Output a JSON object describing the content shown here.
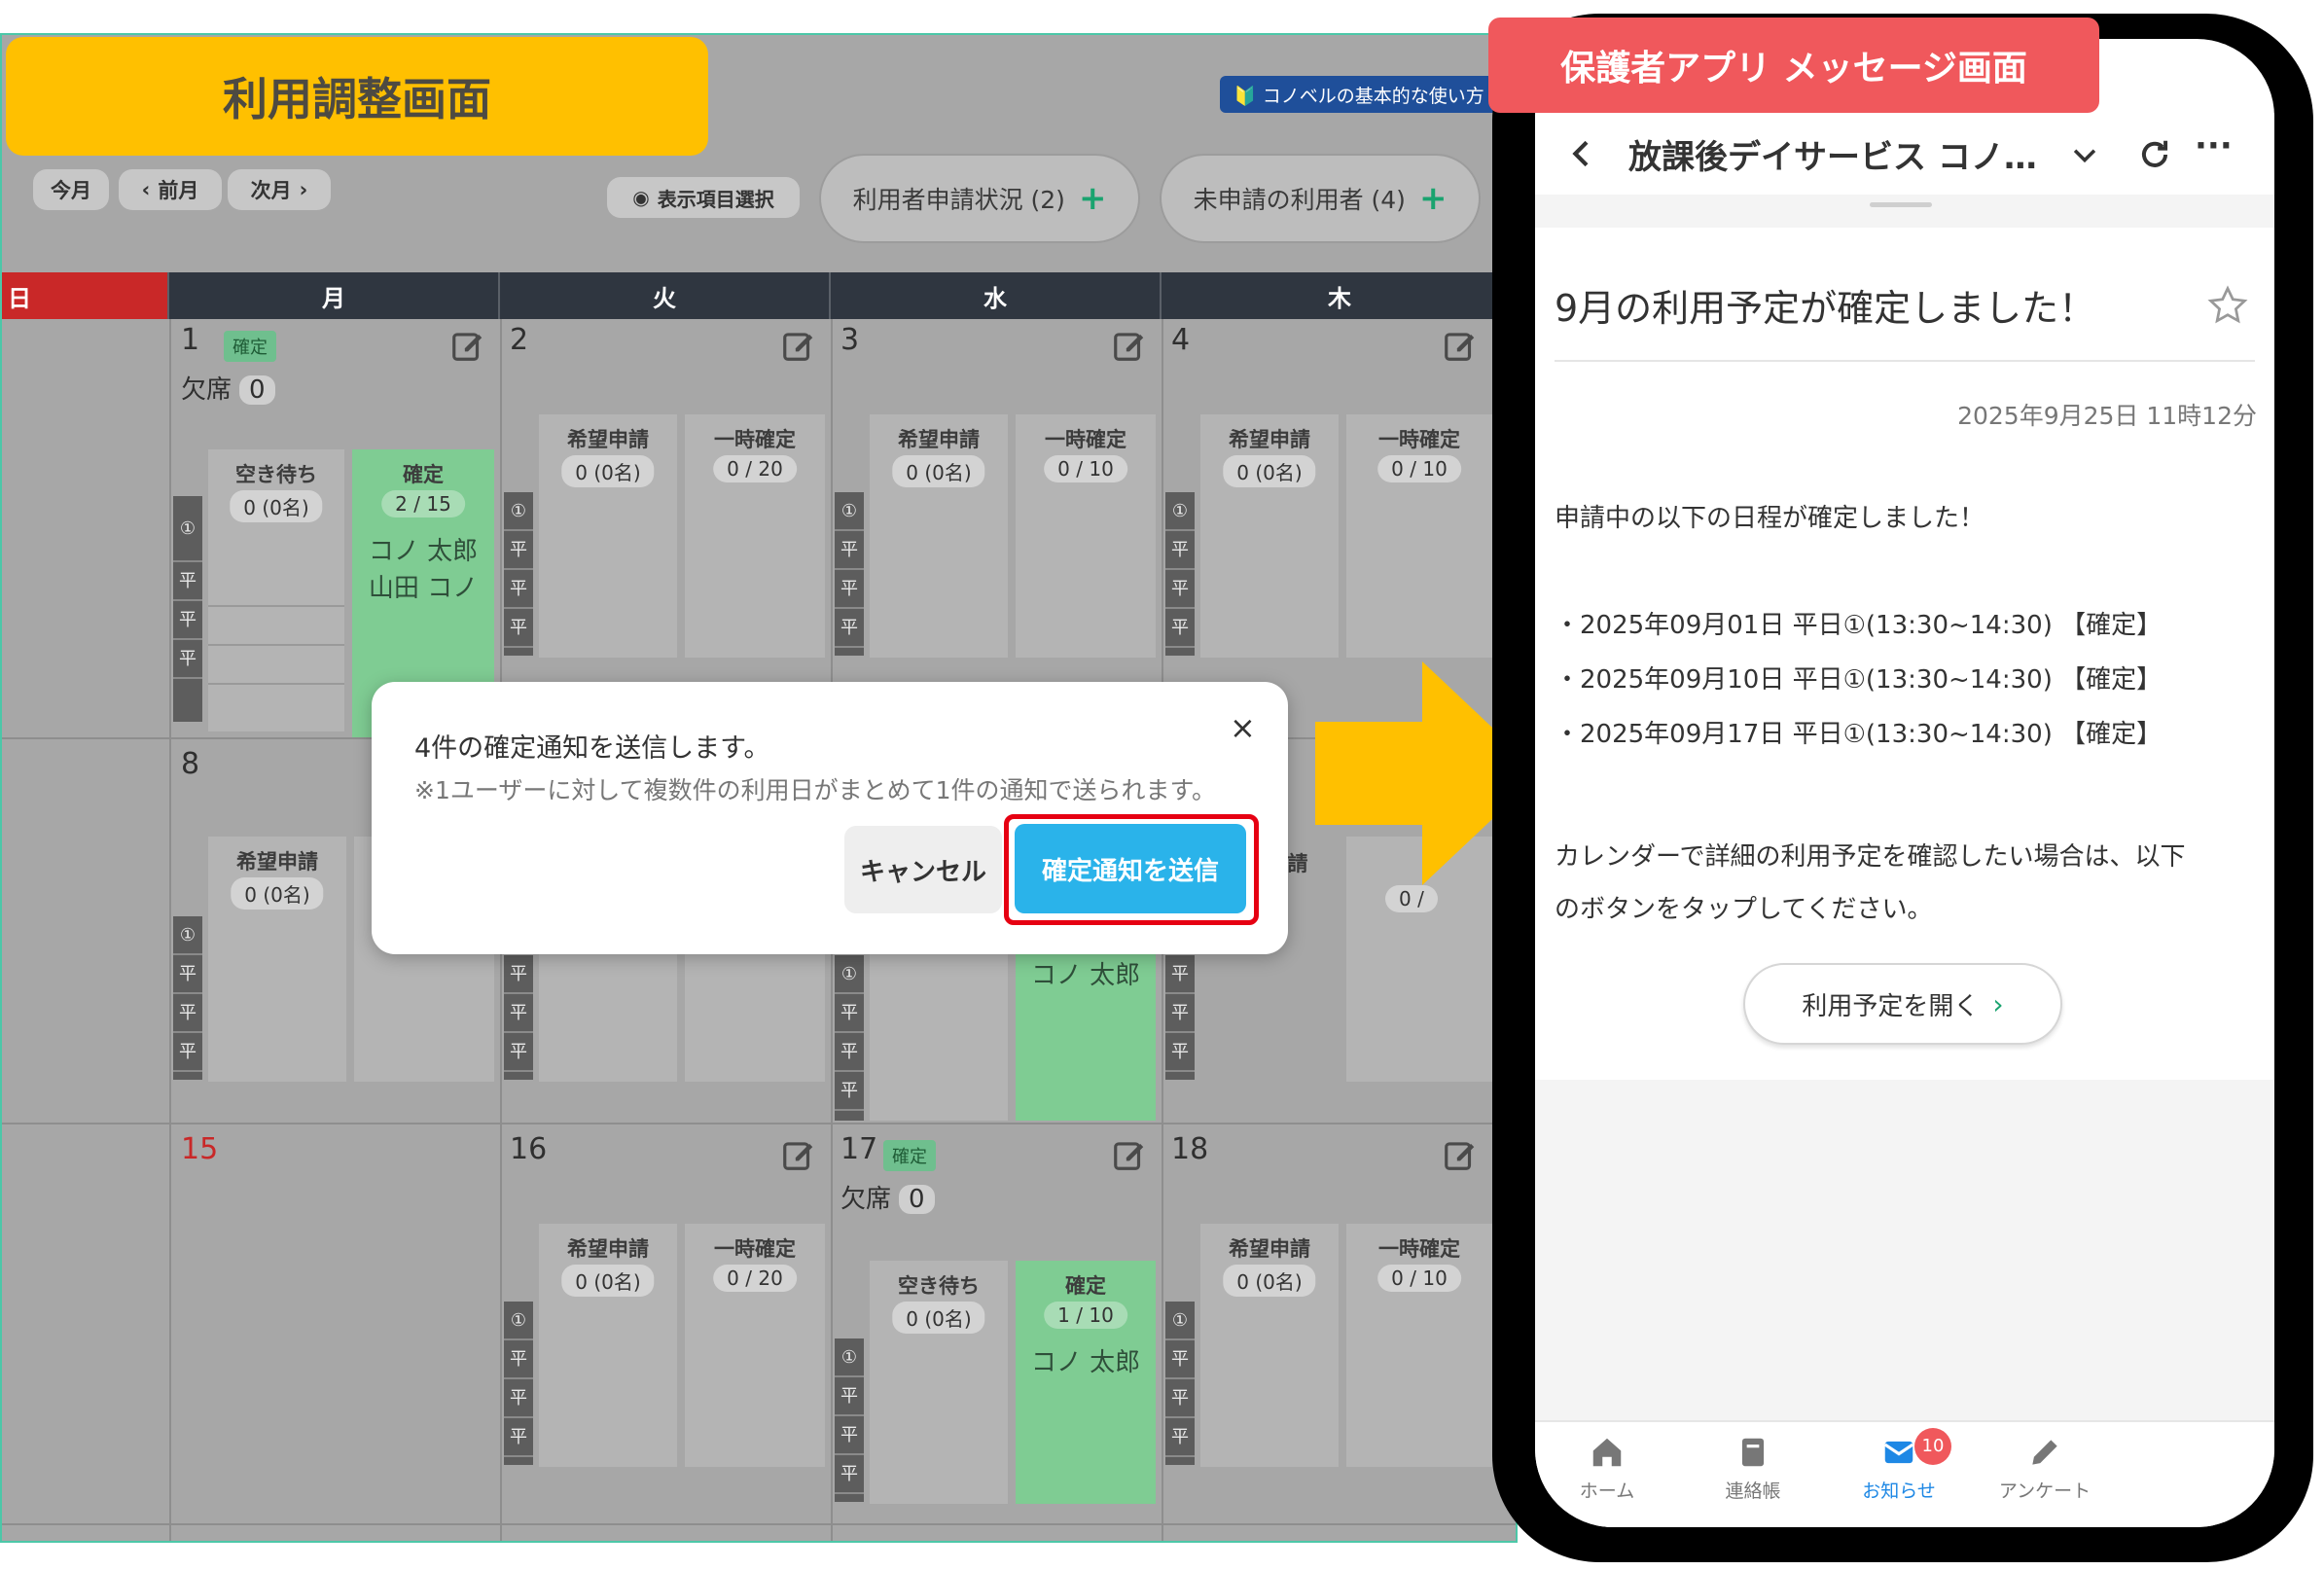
{
  "admin": {
    "title": "利用調整画面",
    "help_link": "🔰 コノベルの基本的な使い方",
    "nav": {
      "today": "今月",
      "prev": "前月",
      "next": "次月"
    },
    "display_select": "表示項目選択",
    "applications_btn": "利用者申請状況 (2)",
    "unapplied_btn": "未申請の利用者 (4)",
    "weekdays": [
      "日",
      "月",
      "火",
      "水",
      "木"
    ],
    "labels": {
      "confirmed": "確定",
      "absent": "欠席",
      "waiting": "空き待ち",
      "request": "希望申請",
      "temp": "一時確定",
      "circle1": "①",
      "weekday_slot": "平"
    },
    "days": {
      "d1": {
        "num": "1",
        "absent_count": "0",
        "waiting": "0 (0名)",
        "confirmed": "2 / 15",
        "names": [
          "コノ 太郎",
          "山田 コノ"
        ]
      },
      "d2": {
        "num": "2",
        "request": "0 (0名)",
        "temp": "0 / 20"
      },
      "d3": {
        "num": "3",
        "request": "0 (0名)",
        "temp": "0 / 10"
      },
      "d4": {
        "num": "4",
        "request": "0 (0名)",
        "temp": "0 / 10"
      },
      "d8": {
        "num": "8",
        "request": "0 (0名)"
      },
      "d10": {
        "partial_request": "請",
        "partial_value": "0 (0名)",
        "partial_temp": "0 /",
        "name": "コノ 太郎"
      },
      "d15": {
        "num": "15"
      },
      "d16": {
        "num": "16",
        "request": "0 (0名)",
        "temp": "0 / 20"
      },
      "d17": {
        "num": "17",
        "absent_count": "0",
        "waiting": "0 (0名)",
        "confirmed": "1 / 10",
        "name": "コノ 太郎"
      },
      "d18": {
        "num": "18",
        "request": "0 (0名)",
        "temp": "0 / 10"
      }
    },
    "modal": {
      "message": "4件の確定通知を送信します。",
      "note": "※1ユーザーに対して複数件の利用日がまとめて1件の通知で送られます。",
      "close": "×",
      "cancel": "キャンセル",
      "send": "確定通知を送信"
    }
  },
  "phone": {
    "label": "保護者アプリ メッセージ画面",
    "header_title": "放課後デイサービス コノ…",
    "message_title": "9月の利用予定が確定しました！",
    "timestamp": "2025年9月25日 11時12分",
    "body_intro": "申請中の以下の日程が確定しました！",
    "schedule": [
      "・2025年09月01日 平日①(13:30~14:30) 【確定】",
      "・2025年09月10日 平日①(13:30~14:30) 【確定】",
      "・2025年09月17日 平日①(13:30~14:30) 【確定】"
    ],
    "body_outro_1": " カレンダーで詳細の利用予定を確認したい場合は、以下",
    "body_outro_2": "のボタンをタップしてください。",
    "open_button": "利用予定を開く",
    "tabs": [
      {
        "label": "ホーム",
        "icon": "home-icon"
      },
      {
        "label": "連絡帳",
        "icon": "notebook-icon"
      },
      {
        "label": "お知らせ",
        "icon": "mail-icon"
      },
      {
        "label": "アンケート",
        "icon": "pencil-icon"
      }
    ],
    "notification_count": "10",
    "active_tab_color": "#1e88e5",
    "badge_color": "#f0585c"
  },
  "colors": {
    "accent_yellow": "#ffc000",
    "label_red": "#f0585c",
    "send_blue": "#2ab3ea",
    "highlight_red": "#e60012"
  }
}
